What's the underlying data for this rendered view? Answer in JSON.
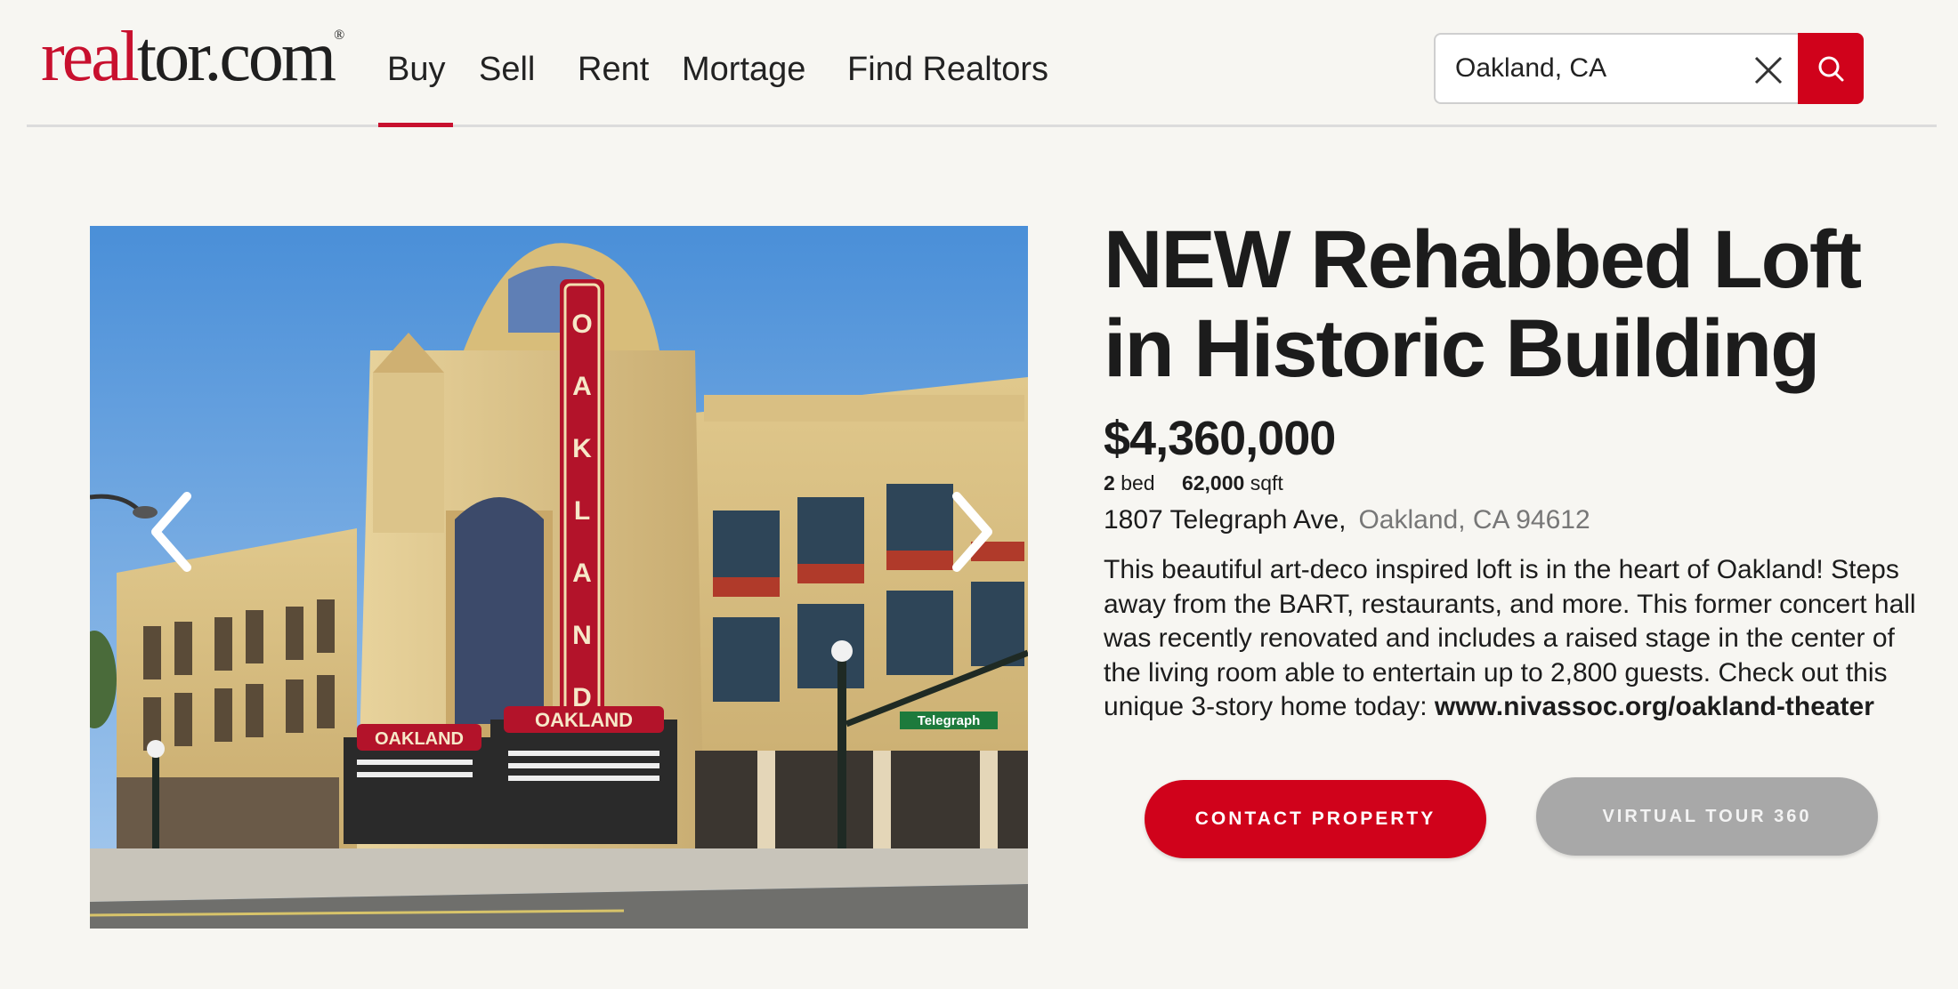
{
  "header": {
    "logo": {
      "part1": "real",
      "part2": "tor.com",
      "reg": "®"
    },
    "nav": [
      "Buy",
      "Sell",
      "Rent",
      "Mortage",
      "Find Realtors"
    ],
    "active_nav": "Buy",
    "search": {
      "value": "Oakland, CA",
      "placeholder": ""
    }
  },
  "listing": {
    "title": "NEW Rehabbed Loft in Historic Building",
    "price": "$4,360,000",
    "beds": {
      "value": "2",
      "unit": "bed"
    },
    "area": {
      "value": "62,000",
      "unit": "sqft"
    },
    "street": "1807 Telegraph Ave,",
    "city": "Oakland, CA 94612",
    "description": "This beautiful art-deco inspired loft is in the heart of Oakland! Steps away from the BART, restaurants, and more. This former concert hall was recently renovated and includes a raised stage in the center of the living room able to entertain up to 2,800 guests. Check out this unique 3-story home today:",
    "link": "www.nivassoc.org/oakland-theater"
  },
  "photo": {
    "sign_text": "OAKLAND",
    "marquee_left": "OAKLAND",
    "marquee_right": "OAKLAND",
    "street_sign": "Telegraph"
  },
  "buttons": {
    "contact": "CONTACT PROPERTY",
    "tour": "VIRTUAL TOUR 360"
  },
  "colors": {
    "brand_red": "#d0021b",
    "background": "#f7f6f2",
    "tour_gray": "#a8a8a8"
  },
  "icons": {
    "clear": "close-icon",
    "search": "search-icon",
    "prev": "chevron-left-icon",
    "next": "chevron-right-icon"
  }
}
